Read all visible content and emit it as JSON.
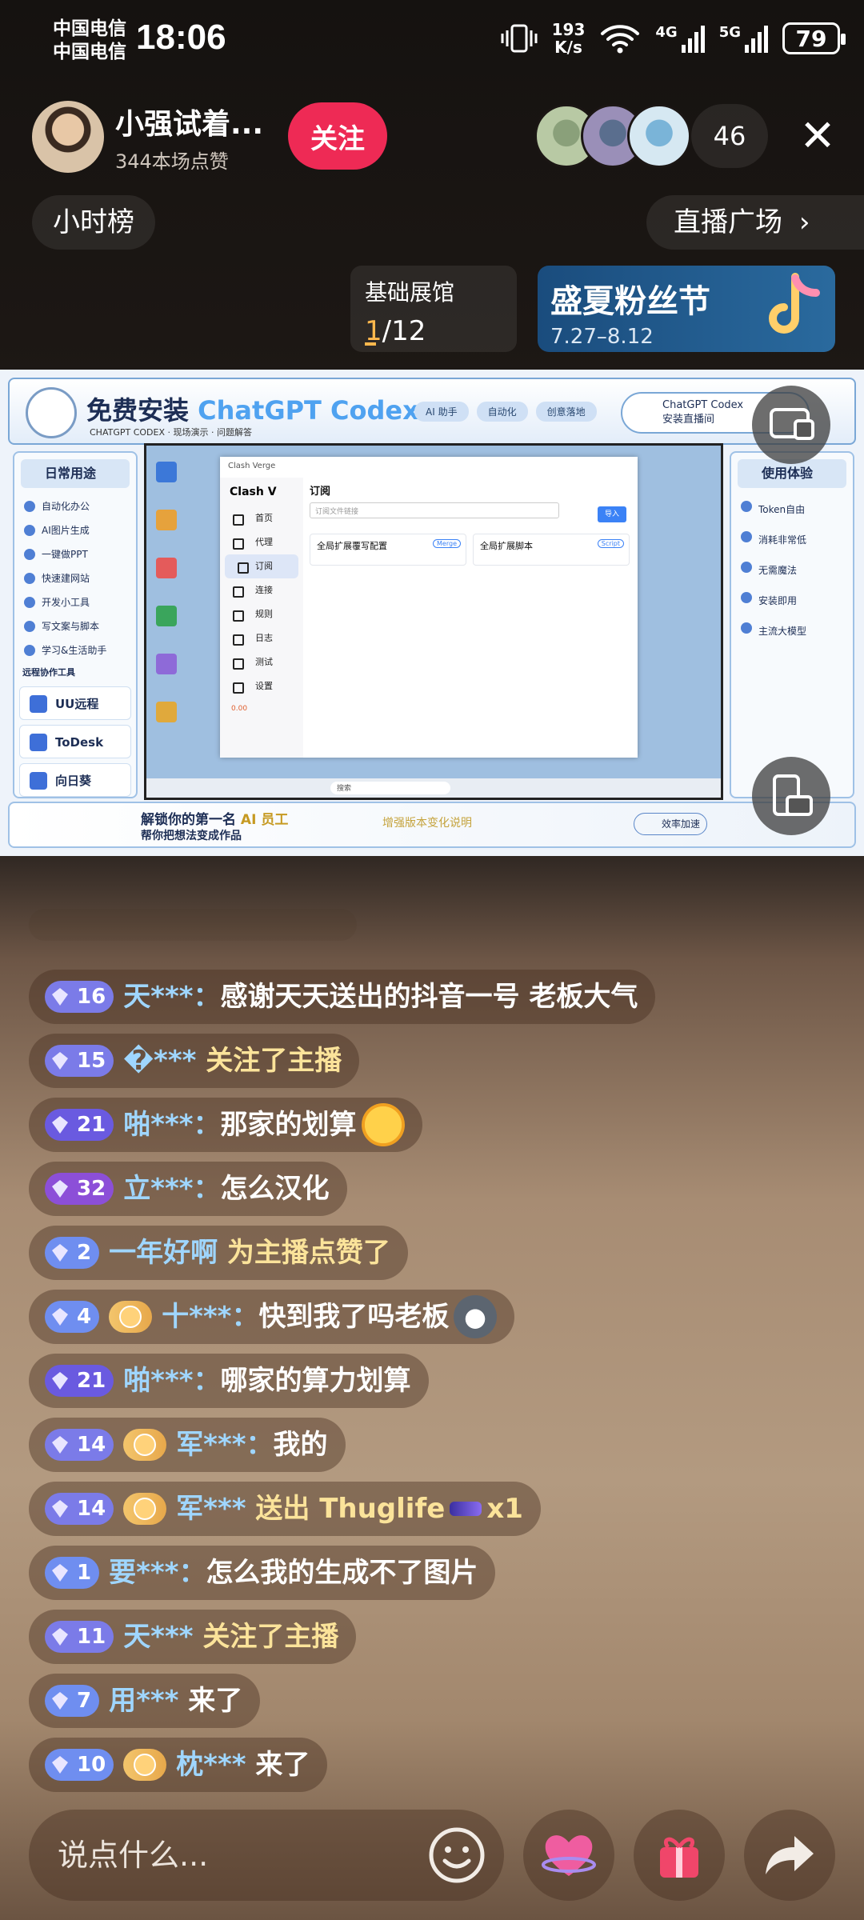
{
  "status_bar": {
    "carrier1": "中国电信",
    "carrier2": "中国电信",
    "time": "18:06",
    "speed_value": "193",
    "speed_unit": "K/s",
    "battery": "79"
  },
  "header": {
    "host_name": "小强试着...",
    "host_likes": "344本场点赞",
    "follow_label": "关注",
    "viewer_count": "46",
    "hour_rank_label": "小时榜",
    "plaza_label": "直播广场",
    "exhibit": {
      "title": "基础展馆",
      "current": "1",
      "total": "/12"
    },
    "festival": {
      "title": "盛夏粉丝节",
      "date": "7.27–8.12"
    }
  },
  "stream": {
    "banner_title_prefix": "免费安装",
    "banner_title_accent": "ChatGPT Codex",
    "banner_subtitle": "CHATGPT CODEX · 现场演示 · 问题解答",
    "banner_pills": [
      "AI 助手",
      "自动化",
      "创意落地"
    ],
    "banner_right_line1": "ChatGPT Codex",
    "banner_right_line2": "安装直播间",
    "left_header": "日常用途",
    "left_items": [
      "自动化办公",
      "AI图片生成",
      "一键做PPT",
      "快速建网站",
      "开发小工具",
      "写文案与脚本",
      "学习&生活助手"
    ],
    "remote_section_title": "远程协作工具",
    "remote_tools": [
      "UU远程",
      "ToDesk",
      "向日葵"
    ],
    "right_header": "使用体验",
    "right_items": [
      "Token自由",
      "消耗非常低",
      "无需魔法",
      "安装即用",
      "主流大模型"
    ],
    "clash": {
      "window_title": "Clash Verge",
      "brand": "Clash V",
      "nav": [
        "首页",
        "代理",
        "订阅",
        "连接",
        "规则",
        "日志",
        "测试",
        "设置"
      ],
      "active_nav": "订阅",
      "page_title": "订阅",
      "url_placeholder": "订阅文件链接",
      "import_label": "导入",
      "card1": "全局扩展覆写配置",
      "card1_tag": "Merge",
      "card2": "全局扩展脚本",
      "card2_tag": "Script",
      "taskbar_search": "搜索",
      "speed": "0.00"
    },
    "footer_title_prefix": "解锁你的第一名",
    "footer_title_accent": "AI 员工",
    "footer_sub": "帮你把想法变成作品",
    "footer_marquee": "增强版本变化说明",
    "footer_pill": "效率加速"
  },
  "chat": [
    {
      "level": "16",
      "level_color": "#7b7be8",
      "fan": false,
      "name": "天***",
      "sep": "：",
      "text": "感谢天天送出的抖音一号 老板大气",
      "act": ""
    },
    {
      "level": "15",
      "level_color": "#7b7be8",
      "fan": false,
      "name": "�***",
      "sep": "",
      "text": "",
      "act": " 关注了主播"
    },
    {
      "level": "21",
      "level_color": "#6a5ae0",
      "fan": false,
      "name": "啪***",
      "sep": "：",
      "text": "那家的划算",
      "act": "",
      "emoji": "laughing-crying-emoji"
    },
    {
      "level": "32",
      "level_color": "#8c4fd8",
      "fan": false,
      "name": "立***",
      "sep": "：",
      "text": "怎么汉化",
      "act": ""
    },
    {
      "level": "2",
      "level_color": "#6f8ef0",
      "fan": false,
      "name": "一年好啊",
      "sep": "",
      "text": "",
      "act": " 为主播点赞了"
    },
    {
      "level": "4",
      "level_color": "#6f8ef0",
      "fan": true,
      "name": "十***",
      "sep": "：",
      "text": "快到我了吗老板",
      "act": "",
      "emoji": "husky-emoji"
    },
    {
      "level": "21",
      "level_color": "#6a5ae0",
      "fan": false,
      "name": "啪***",
      "sep": "：",
      "text": "哪家的算力划算",
      "act": ""
    },
    {
      "level": "14",
      "level_color": "#7b7be8",
      "fan": true,
      "name": "军***",
      "sep": "：",
      "text": "我的",
      "act": ""
    },
    {
      "level": "14",
      "level_color": "#7b7be8",
      "fan": true,
      "name": "军***",
      "sep": "",
      "text": "",
      "act": " 送出 Thuglife",
      "gift": "sunglasses-gift-icon",
      "gift_count": "x1"
    },
    {
      "level": "1",
      "level_color": "#6f8ef0",
      "fan": false,
      "name": "要***",
      "sep": "：",
      "text": "怎么我的生成不了图片",
      "act": ""
    },
    {
      "level": "11",
      "level_color": "#7b7be8",
      "fan": false,
      "name": "天***",
      "sep": "",
      "text": "",
      "act": " 关注了主播"
    },
    {
      "level": "7",
      "level_color": "#6f8ef0",
      "fan": false,
      "name": "用***",
      "sep": "",
      "text": "",
      "act": " 来了",
      "act_plain": true
    },
    {
      "level": "10",
      "level_color": "#6f8ef0",
      "fan": true,
      "name": "枕***",
      "sep": "",
      "text": "",
      "act": " 来了",
      "act_plain": true
    }
  ],
  "input": {
    "placeholder": "说点什么..."
  },
  "icons": {
    "signal": "signal-bars-icon",
    "wifi": "wifi-icon",
    "vibrate": "vibrate-icon",
    "close": "close-icon",
    "chevron": "chevron-right-icon",
    "smile": "smile-icon",
    "heart": "heart-icon",
    "gift": "gift-icon",
    "share": "share-icon"
  },
  "colors": {
    "follow": "#ee2a55",
    "accent_orange": "#ffb84d",
    "chat_name": "#9fd6ff",
    "chat_action": "#fbe39a"
  }
}
